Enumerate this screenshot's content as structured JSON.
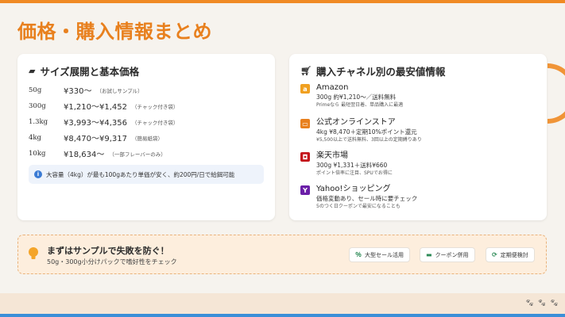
{
  "page": {
    "title": "価格・購入情報まとめ"
  },
  "colors": {
    "accent": "#e8801e",
    "info": "#3b7bd4",
    "amazon": "#f0a020",
    "official": "#e8801e",
    "rakuten": "#c4161c",
    "yahoo": "#6b1fa8"
  },
  "left_card": {
    "icon": "box-icon",
    "title": "サイズ展開と基本価格",
    "rows": [
      {
        "size": "50g",
        "price": "¥330〜",
        "note": "（お試しサンプル）"
      },
      {
        "size": "300g",
        "price": "¥1,210〜¥1,452",
        "note": "（チャック付き袋）"
      },
      {
        "size": "1.3kg",
        "price": "¥3,993〜¥4,356",
        "note": "（チャック付き袋）"
      },
      {
        "size": "4kg",
        "price": "¥8,470〜¥9,317",
        "note": "（簡易紙袋）"
      },
      {
        "size": "10kg",
        "price": "¥18,634〜",
        "note": "（一部フレーバーのみ）"
      }
    ],
    "info": "大容量（4kg）が最も100gあたり単価が安く、約200円/日で給餌可能"
  },
  "right_card": {
    "icon": "cart-icon",
    "title": "購入チャネル別の最安値情報",
    "channels": [
      {
        "icon": "amazon-icon",
        "glyph": "a",
        "name": "Amazon",
        "line1": "300g 約¥1,210〜／送料無料",
        "line2": "Primeなら 最短翌日着、単品購入に最適"
      },
      {
        "icon": "store-icon",
        "glyph": "▭",
        "name": "公式オンラインストア",
        "line1": "4kg ¥8,470＋定期10%ポイント還元",
        "line2": "¥5,500以上で送料無料、3回以上の定期縛りあり"
      },
      {
        "icon": "rakuten-icon",
        "glyph": "◘",
        "name": "楽天市場",
        "line1": "300g ¥1,331＋送料¥660",
        "line2": "ポイント倍率に注目、SPUでお得に"
      },
      {
        "icon": "yahoo-icon",
        "glyph": "Y",
        "name": "Yahoo!ショッピング",
        "line1": "価格変動あり、セール時に要チェック",
        "line2": "5のつく日クーポンで最安になることも"
      }
    ]
  },
  "tip": {
    "title": "まずはサンプルで失敗を防ぐ！",
    "subtitle": "50g・300g小分けパックで嗜好性をチェック",
    "chips": [
      {
        "icon": "percent-icon",
        "glyph": "％",
        "label": "大型セール活用"
      },
      {
        "icon": "coupon-icon",
        "glyph": "▬",
        "label": "クーポン併用"
      },
      {
        "icon": "refresh-icon",
        "glyph": "⟳",
        "label": "定期便検討"
      }
    ]
  }
}
